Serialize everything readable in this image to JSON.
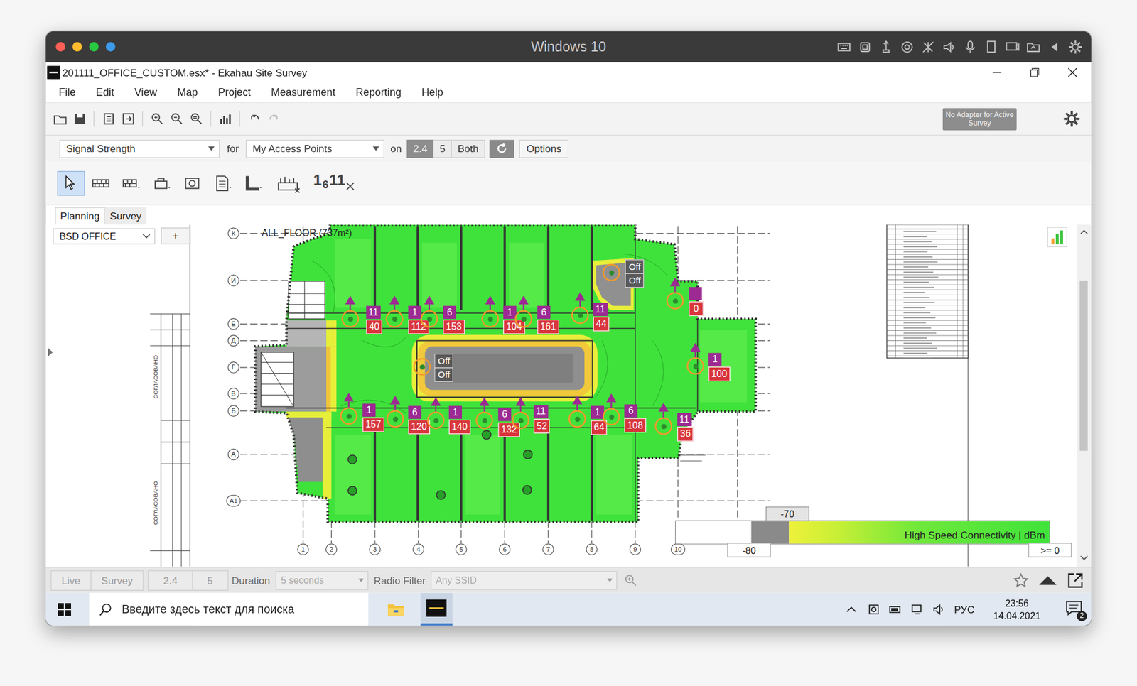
{
  "host_window": {
    "title": "Windows 10"
  },
  "app_window": {
    "title": "201111_OFFICE_CUSTOM.esx* - Ekahau Site Survey"
  },
  "menu": [
    "File",
    "Edit",
    "View",
    "Map",
    "Project",
    "Measurement",
    "Reporting",
    "Help"
  ],
  "toolbar": {
    "adapter_badge": "No Adapter for Active Survey"
  },
  "visualization": {
    "metric": "Signal Strength",
    "for_label": "for",
    "target": "My Access Points",
    "on_label": "on",
    "bands": [
      {
        "label": "2.4",
        "selected": true
      },
      {
        "label": "5",
        "selected": false
      },
      {
        "label": "Both",
        "selected": false
      }
    ],
    "options_button": "Options"
  },
  "tools": [
    {
      "selected": true
    },
    {
      "selected": false
    },
    {
      "selected": false
    },
    {
      "selected": false
    },
    {
      "selected": false
    },
    {
      "selected": false
    },
    {
      "selected": false
    },
    {
      "selected": false
    }
  ],
  "channel_tool": {
    "labels": [
      "1",
      "6",
      "11"
    ],
    "selected": false
  },
  "mode_tabs": [
    {
      "label": "Planning",
      "selected": true
    },
    {
      "label": "Survey",
      "selected": false
    }
  ],
  "floor": {
    "selected": "BSD OFFICE",
    "add_button": "+"
  },
  "map": {
    "floor_label": "ALL_FLOOR (737m²)",
    "row_axis": [
      "К",
      "И",
      "Е",
      "Д",
      "Г",
      "В",
      "Б",
      "А",
      "А1"
    ],
    "col_axis": [
      "1",
      "2",
      "3",
      "4",
      "5",
      "6",
      "7",
      "8",
      "9",
      "10"
    ],
    "stamp_texts": [
      "СОГЛАСОВАНО",
      "СОГЛАСОВАНО"
    ],
    "access_points": [
      {
        "kind": "on",
        "channel": "11",
        "name": "40"
      },
      {
        "kind": "on",
        "channel": "1",
        "name": "112"
      },
      {
        "kind": "on",
        "channel": "6",
        "name": "153"
      },
      {
        "kind": "on",
        "channel": "1",
        "name": "104"
      },
      {
        "kind": "on",
        "channel": "6",
        "name": "161"
      },
      {
        "kind": "on",
        "channel": "11",
        "name": "44"
      },
      {
        "kind": "off",
        "labels": [
          "Off",
          "Off"
        ]
      },
      {
        "kind": "on",
        "channel": "",
        "name": "0"
      },
      {
        "kind": "on",
        "channel": "1",
        "name": "100"
      },
      {
        "kind": "off",
        "labels": [
          "Off",
          "Off"
        ]
      },
      {
        "kind": "on",
        "channel": "1",
        "name": "157"
      },
      {
        "kind": "on",
        "channel": "6",
        "name": "120"
      },
      {
        "kind": "on",
        "channel": "1",
        "name": "140"
      },
      {
        "kind": "on",
        "channel": "6",
        "name": "132"
      },
      {
        "kind": "on",
        "channel": "11",
        "name": "52"
      },
      {
        "kind": "on",
        "channel": "1",
        "name": "64"
      },
      {
        "kind": "on",
        "channel": "6",
        "name": "108"
      },
      {
        "kind": "on",
        "channel": "11",
        "name": "36"
      }
    ]
  },
  "legend": {
    "threshold": "-70",
    "min": "-80",
    "max": ">= 0",
    "label": "High Speed Connectivity |  dBm"
  },
  "bottom_bar": {
    "modes": [
      {
        "label": "Live",
        "disabled": true
      },
      {
        "label": "Survey",
        "disabled": true
      }
    ],
    "bands": [
      {
        "label": "2.4",
        "disabled": true
      },
      {
        "label": "5",
        "disabled": true
      }
    ],
    "duration_label": "Duration",
    "duration": "5 seconds",
    "duration_disabled": true,
    "radio_filter_label": "Radio Filter",
    "radio_filter": "Any SSID",
    "radio_filter_disabled": true
  },
  "taskbar": {
    "search_placeholder": "Введите здесь текст для поиска",
    "ekahau_active": true,
    "language": "РУС",
    "time": "23:56",
    "date": "14.04.2021",
    "notifications": "2"
  }
}
